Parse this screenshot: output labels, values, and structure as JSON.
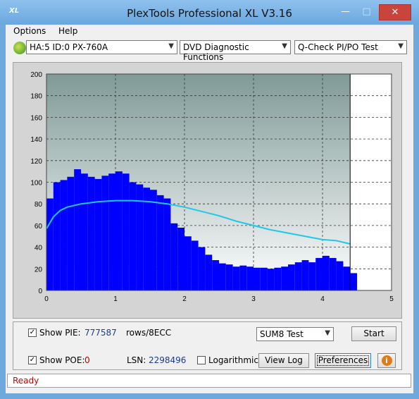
{
  "window": {
    "title": "PlexTools Professional XL V3.16",
    "icon_text": "XL"
  },
  "menu": [
    {
      "label": "Options"
    },
    {
      "label": "Help"
    }
  ],
  "toolbar": {
    "drive": "HA:5 ID:0  PX-760A",
    "function": "DVD Diagnostic Functions",
    "test": "Q-Check PI/PO Test"
  },
  "chart_data": {
    "type": "bar",
    "xlim": [
      0,
      5
    ],
    "ylim": [
      0,
      200
    ],
    "x_ticks": [
      "0",
      "1",
      "2",
      "3",
      "4",
      "5"
    ],
    "y_ticks": [
      "0",
      "20",
      "40",
      "60",
      "80",
      "100",
      "120",
      "140",
      "160",
      "180",
      "200"
    ],
    "data_end_x": 4.4,
    "grid": true,
    "series": [
      {
        "kind": "bars",
        "color": "#0000ff",
        "x": [
          0,
          0.1,
          0.2,
          0.3,
          0.4,
          0.5,
          0.6,
          0.7,
          0.8,
          0.9,
          1.0,
          1.1,
          1.2,
          1.3,
          1.4,
          1.5,
          1.6,
          1.7,
          1.8,
          1.9,
          2.0,
          2.1,
          2.2,
          2.3,
          2.4,
          2.5,
          2.6,
          2.7,
          2.8,
          2.9,
          3.0,
          3.1,
          3.2,
          3.3,
          3.4,
          3.5,
          3.6,
          3.7,
          3.8,
          3.9,
          4.0,
          4.1,
          4.2,
          4.3,
          4.4
        ],
        "y": [
          85,
          100,
          102,
          105,
          112,
          108,
          105,
          103,
          106,
          108,
          110,
          108,
          100,
          98,
          95,
          93,
          88,
          85,
          62,
          58,
          50,
          46,
          40,
          33,
          28,
          25,
          24,
          22,
          23,
          22,
          21,
          21,
          20,
          21,
          22,
          24,
          26,
          28,
          26,
          30,
          32,
          30,
          27,
          22,
          16
        ]
      },
      {
        "kind": "line",
        "color": "#1fc8e8",
        "x": [
          0,
          0.1,
          0.2,
          0.3,
          0.5,
          0.75,
          1.0,
          1.25,
          1.5,
          1.75,
          2.0,
          2.25,
          2.5,
          2.75,
          3.0,
          3.25,
          3.5,
          3.75,
          4.0,
          4.2,
          4.4
        ],
        "y": [
          57,
          68,
          74,
          77,
          80,
          82,
          83,
          83,
          82,
          80,
          77,
          73,
          69,
          64,
          60,
          56,
          53,
          50,
          47,
          46,
          43
        ]
      }
    ]
  },
  "controls": {
    "show_pie_label": "Show PIE:",
    "pie_value": "777587",
    "rows_label": "rows/8ECC",
    "sum_select": "SUM8 Test",
    "start_label": "Start",
    "show_poe_label": "Show POE:",
    "poe_value": "0",
    "lsn_label": "LSN:",
    "lsn_value": "2298496",
    "log_label": "Logarithmic",
    "viewlog_label": "View Log",
    "prefs_label": "Preferences",
    "info_label": "i"
  },
  "status": {
    "text": "Ready"
  }
}
